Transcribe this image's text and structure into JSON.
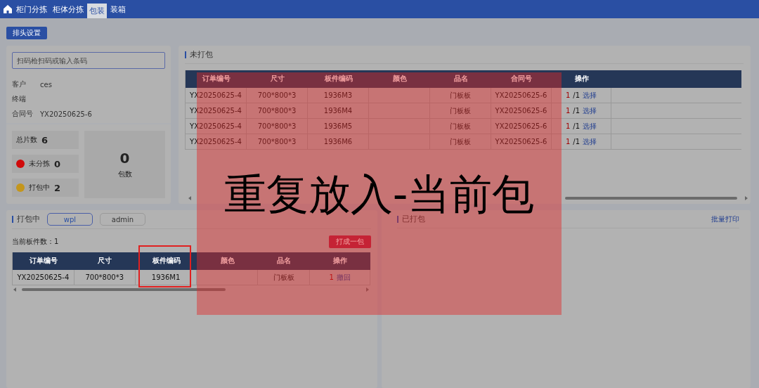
{
  "nav": {
    "tabs": [
      {
        "label": "柜门分拣",
        "selected": false
      },
      {
        "label": "柜体分拣",
        "selected": false
      },
      {
        "label": "包装",
        "selected": true
      },
      {
        "label": "装箱",
        "selected": false
      }
    ]
  },
  "toolbar": {
    "button": "排头设置"
  },
  "scan": {
    "placeholder": "扫码枪扫码或输入条码",
    "fields": [
      {
        "label": "客户",
        "value": "ces"
      },
      {
        "label": "终端"
      },
      {
        "label": "合同号",
        "value": "YX20250625-6"
      }
    ]
  },
  "stats": {
    "items": [
      {
        "label": "总片数",
        "value": "6"
      },
      {
        "label": "未分拣",
        "value": "0",
        "color": "#d00a0a"
      },
      {
        "label": "打包中",
        "value": "2",
        "color": "#c4961c"
      }
    ],
    "packages": {
      "value": "0",
      "label": "包数"
    }
  },
  "unpacked": {
    "title": "未打包",
    "columns": [
      "订单编号",
      "尺寸",
      "板件编码",
      "颜色",
      "品名",
      "合同号",
      "操作"
    ],
    "rows": [
      {
        "cells": [
          "YX20250625-4",
          "700*800*3",
          "1936M3",
          "",
          "门板板",
          "YX20250625-6"
        ],
        "count": "1",
        "total": "/1",
        "action": "选择"
      },
      {
        "cells": [
          "YX20250625-4",
          "700*800*3",
          "1936M4",
          "",
          "门板板",
          "YX20250625-6"
        ],
        "count": "1",
        "total": "/1",
        "action": "选择"
      },
      {
        "cells": [
          "YX20250625-4",
          "700*800*3",
          "1936M5",
          "",
          "门板板",
          "YX20250625-6"
        ],
        "count": "1",
        "total": "/1",
        "action": "选择"
      },
      {
        "cells": [
          "YX20250625-4",
          "700*800*3",
          "1936M6",
          "",
          "门板板",
          "YX20250625-6"
        ],
        "count": "1",
        "total": "/1",
        "action": "选择"
      }
    ]
  },
  "packing": {
    "title": "打包中",
    "users": [
      {
        "label": "wpl",
        "selected": true
      },
      {
        "label": "admin",
        "selected": false
      }
    ],
    "count_label": "当前板件数：1",
    "pack_button": "打成一包",
    "columns": [
      "订单编号",
      "尺寸",
      "板件编码",
      "颜色",
      "品名",
      "操作"
    ],
    "rows": [
      {
        "cells": [
          "YX20250625-4",
          "700*800*3",
          "1936M1",
          "",
          "门板板"
        ],
        "count": "1",
        "action": "撤回"
      }
    ]
  },
  "packed": {
    "title": "已打包",
    "link": "批量打印"
  },
  "alert": {
    "message": "重复放入-当前包"
  }
}
